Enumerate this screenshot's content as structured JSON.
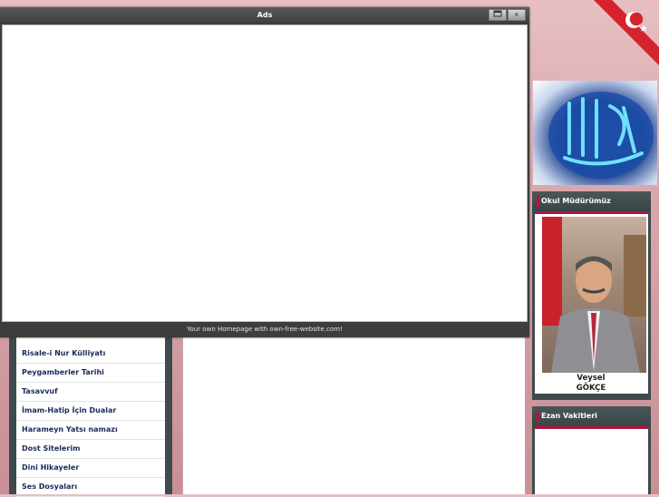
{
  "ads": {
    "title": "Ads",
    "footer": "Your own Homepage with own-free-website.com!",
    "min_icon": "minimize-icon",
    "close_label": "x"
  },
  "nav": {
    "items": [
      {
        "label": "Risale-i Nur Külliyatı"
      },
      {
        "label": "Peygamberler Tarihi"
      },
      {
        "label": "Tasavvuf"
      },
      {
        "label": "İmam-Hatip İçin Dualar"
      },
      {
        "label": "Harameyn Yatsı namazı"
      },
      {
        "label": "Dost Sitelerim"
      },
      {
        "label": "Dini Hikayeler"
      },
      {
        "label": "Ses Dosyaları"
      }
    ]
  },
  "principal": {
    "heading": "Okul Müdürümüz",
    "first_name": "Veysel",
    "last_name": "GÖKÇE"
  },
  "prayer": {
    "heading": "Ezan Vakitleri"
  },
  "colors": {
    "accent": "#b3153d",
    "panel": "#3e4a4c",
    "flag_red": "#d5232b"
  }
}
